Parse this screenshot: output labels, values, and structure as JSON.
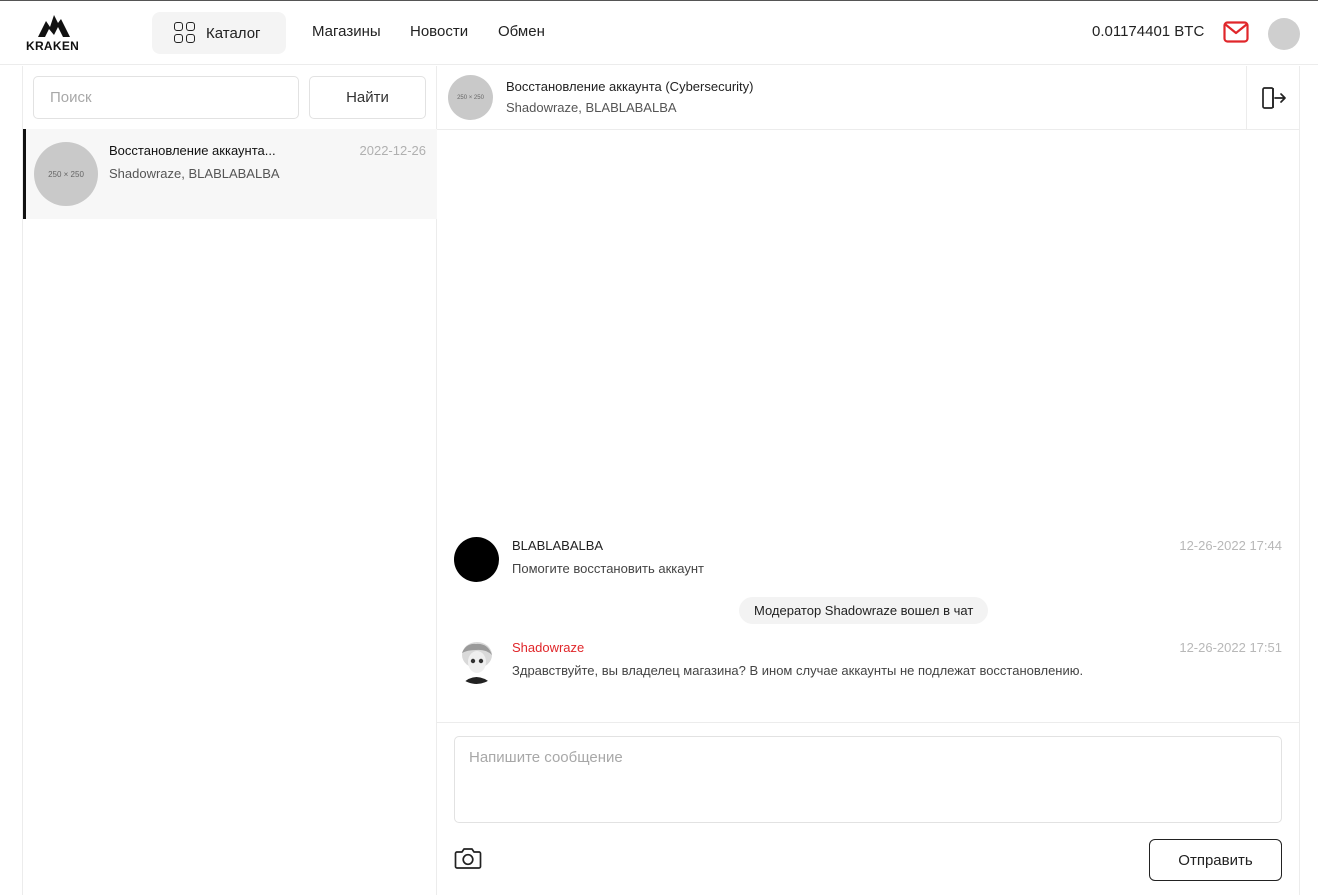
{
  "header": {
    "logo_text": "KRAKEN",
    "catalog_label": "Каталог",
    "nav": [
      "Магазины",
      "Новости",
      "Обмен"
    ],
    "balance": "0.01174401 BTC",
    "accent_color": "#e0262a"
  },
  "sidebar": {
    "search_placeholder": "Поиск",
    "search_button": "Найти",
    "chats": [
      {
        "thumb_text": "250 × 250",
        "title": "Восстановление аккаунта...",
        "date": "2022-12-26",
        "members": "Shadowraze, BLABLABALBA"
      }
    ]
  },
  "chat": {
    "thumb_text": "250 × 250",
    "title": "Восстановление аккаунта (Cybersecurity)",
    "members": "Shadowraze, BLABLABALBA",
    "messages": [
      {
        "author": "BLABLABALBA",
        "time": "12-26-2022 17:44",
        "text": "Помогите восстановить аккаунт"
      },
      {
        "system": "Модератор Shadowraze вошел в чат"
      },
      {
        "author": "Shadowraze",
        "time": "12-26-2022 17:51",
        "text": "Здравствуйте, вы владелец магазина? В ином случае аккаунты не подлежат восстановлению."
      }
    ],
    "input_placeholder": "Напишите сообщение",
    "send_label": "Отправить"
  }
}
